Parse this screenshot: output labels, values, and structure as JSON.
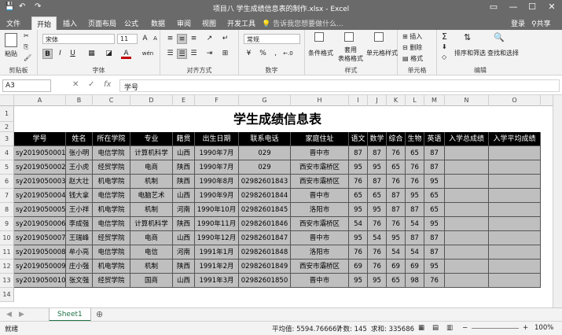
{
  "title_bar": {
    "title": "项目八 学生成绩信息表的制作.xlsx - Excel",
    "quick_access": [
      "💾",
      "↶",
      "↷"
    ],
    "window_controls": [
      "▭",
      "—",
      "☐",
      "✕"
    ]
  },
  "tabs": [
    "文件",
    "开始",
    "插入",
    "页面布局",
    "公式",
    "数据",
    "审阅",
    "视图",
    "开发工具"
  ],
  "active_tab": "开始",
  "tell_me": "告诉我您想要做什么...",
  "account": {
    "login": "登录",
    "share": "共享"
  },
  "ribbon": {
    "clipboard": {
      "label": "剪贴板",
      "paste": "粘贴"
    },
    "font": {
      "label": "字体",
      "font_name": "宋体",
      "font_size": "11",
      "bold": "B",
      "italic": "I",
      "underline": "U",
      "grow": "A",
      "shrink": "A",
      "font_color": "A",
      "phonetic": "wén"
    },
    "alignment": {
      "label": "对齐方式"
    },
    "number": {
      "label": "数字",
      "format": "常规",
      "percent": "%",
      "comma": ",",
      "currency": "¥"
    },
    "styles": {
      "label": "样式",
      "conditional": "条件格式",
      "table_format_1": "套用",
      "table_format_2": "表格格式",
      "cell_styles": "单元格样式"
    },
    "cells": {
      "label": "单元格",
      "insert": "插入",
      "delete": "删除",
      "format": "格式"
    },
    "editing": {
      "label": "编辑",
      "sort": "排序和筛选",
      "find": "查找和选择",
      "sum": "Σ"
    }
  },
  "formula_bar": {
    "name_box": "A3",
    "formula": "学号",
    "fx": "fx",
    "cancel": "✕",
    "enter": "✓"
  },
  "columns": [
    "A",
    "B",
    "C",
    "D",
    "E",
    "F",
    "G",
    "H",
    "I",
    "J",
    "K",
    "L",
    "M",
    "N",
    "O"
  ],
  "rows": [
    "1",
    "2",
    "3",
    "4",
    "5",
    "6",
    "7",
    "8",
    "9",
    "10",
    "11",
    "12",
    "13",
    "14"
  ],
  "sheet_title": "学生成绩信息表",
  "headers": [
    "学号",
    "姓名",
    "所在学院",
    "专业",
    "籍贯",
    "出生日期",
    "联系电话",
    "家庭住址",
    "语文",
    "数学",
    "综合",
    "生物",
    "英语",
    "入学总成绩",
    "入学平均成绩"
  ],
  "data": [
    [
      "sy2019050001",
      "张小明",
      "电信学院",
      "计算机科学",
      "山西",
      "1990年7月",
      "029",
      "晋中市",
      "87",
      "87",
      "76",
      "65",
      "87",
      "",
      ""
    ],
    [
      "sy2019050002",
      "王小虎",
      "经贸学院",
      "电商",
      "陕西",
      "1990年7月",
      "029",
      "西安市灞桥区",
      "95",
      "95",
      "65",
      "76",
      "87",
      "",
      ""
    ],
    [
      "sy2019050003",
      "赵大壮",
      "机电学院",
      "机制",
      "陕西",
      "1990年8月",
      "02982601843",
      "西安市灞桥区",
      "76",
      "87",
      "76",
      "76",
      "95",
      "",
      ""
    ],
    [
      "sy2019050004",
      "钱大拿",
      "电信学院",
      "电脑艺术",
      "山西",
      "1990年9月",
      "02982601844",
      "晋中市",
      "65",
      "65",
      "87",
      "95",
      "65",
      "",
      ""
    ],
    [
      "sy2019050005",
      "王小祥",
      "机电学院",
      "机制",
      "河南",
      "1990年10月",
      "02982601845",
      "洛阳市",
      "95",
      "95",
      "87",
      "87",
      "65",
      "",
      ""
    ],
    [
      "sy2019050006",
      "李成强",
      "电信学院",
      "计算机科学",
      "陕西",
      "1990年11月",
      "02982601846",
      "西安市灞桥区",
      "54",
      "76",
      "76",
      "54",
      "95",
      "",
      ""
    ],
    [
      "sy2019050007",
      "王瑞峰",
      "经贸学院",
      "电商",
      "山西",
      "1990年12月",
      "02982601847",
      "晋中市",
      "95",
      "54",
      "95",
      "87",
      "87",
      "",
      ""
    ],
    [
      "sy2019050008",
      "牟小亮",
      "电信学院",
      "电信",
      "河南",
      "1991年1月",
      "02982601848",
      "洛阳市",
      "76",
      "76",
      "54",
      "54",
      "87",
      "",
      ""
    ],
    [
      "sy2019050009",
      "庄小强",
      "机电学院",
      "机制",
      "陕西",
      "1991年2月",
      "02982601849",
      "西安市灞桥区",
      "69",
      "76",
      "69",
      "69",
      "95",
      "",
      ""
    ],
    [
      "sy2019050010",
      "张文强",
      "经贸学院",
      "国商",
      "山西",
      "1991年3月",
      "02982601850",
      "晋中市",
      "95",
      "95",
      "65",
      "98",
      "76",
      "",
      ""
    ]
  ],
  "sheet_tab": "Sheet1",
  "add_sheet": "⊕",
  "status": {
    "ready": "就绪",
    "average": "平均值: 5594.766667",
    "count": "计数: 145",
    "sum": "求和: 335686",
    "zoom": "100%"
  }
}
